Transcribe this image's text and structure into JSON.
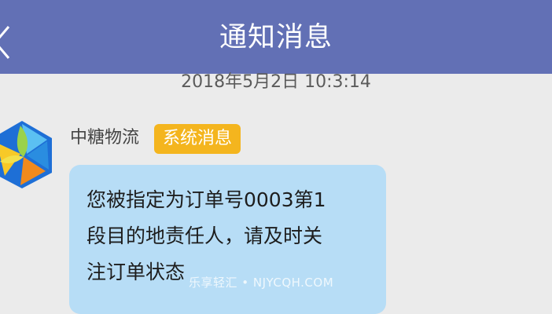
{
  "header": {
    "title": "通知消息",
    "back_icon": "chevron-left-icon"
  },
  "timestamp": "2018年5月2日 10:3:14",
  "message": {
    "avatar_icon": "company-logo-icon",
    "sender": "中糖物流",
    "badge": "系统消息",
    "text": "您被指定为订单号0003第1\n段目的地责任人，请及时关\n注订单状态"
  },
  "watermark": "乐享轻汇 • NJYCQH.COM",
  "colors": {
    "header_bg": "#6270b5",
    "page_bg": "#ebebeb",
    "badge_bg": "#f4b51e",
    "bubble_bg": "#b7ddf6"
  }
}
